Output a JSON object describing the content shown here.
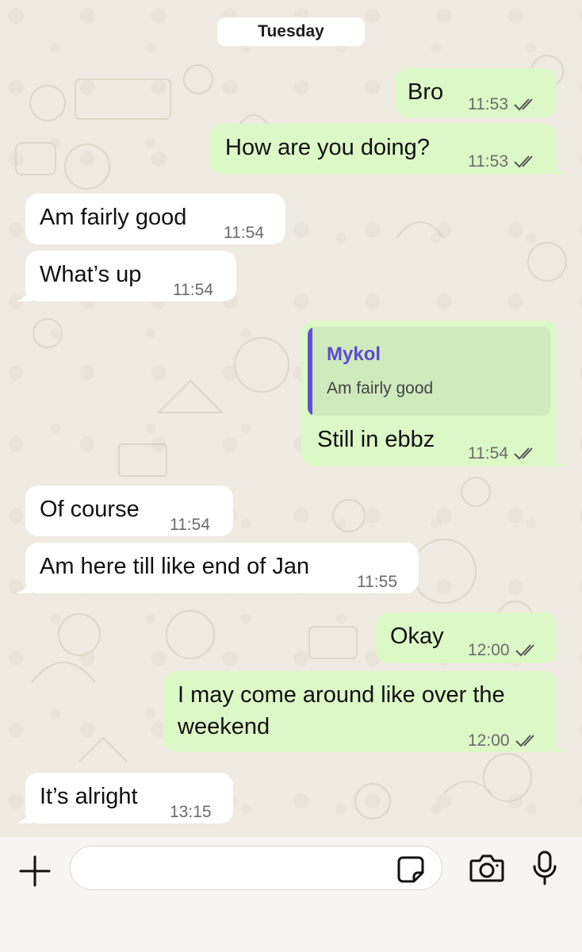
{
  "date_separator": "Tuesday",
  "messages": [
    {
      "direction": "out",
      "text": "Bro",
      "time": "11:53",
      "status": "read"
    },
    {
      "direction": "out",
      "text": "How are you doing?",
      "time": "11:53",
      "status": "read"
    },
    {
      "direction": "in",
      "text": "Am fairly good",
      "time": "11:54"
    },
    {
      "direction": "in",
      "text": "What’s up",
      "time": "11:54"
    },
    {
      "direction": "out",
      "reply_to": {
        "author": "Mykol",
        "text": "Am fairly good"
      },
      "text": "Still in ebbz",
      "time": "11:54",
      "status": "read"
    },
    {
      "direction": "in",
      "text": "Of course",
      "time": "11:54"
    },
    {
      "direction": "in",
      "text": "Am here till like end of Jan",
      "time": "11:55"
    },
    {
      "direction": "out",
      "text": "Okay",
      "time": "12:00",
      "status": "read"
    },
    {
      "direction": "out",
      "text_lines": [
        "I may come around like over the",
        "weekend"
      ],
      "time": "12:00",
      "status": "read"
    },
    {
      "direction": "in",
      "text": "It’s alright",
      "time": "13:15"
    }
  ],
  "composer": {
    "placeholder": "",
    "icons": [
      "plus-icon",
      "sticker-icon",
      "camera-icon",
      "microphone-icon"
    ]
  },
  "colors": {
    "chat_background": "#efeae2",
    "incoming_bubble": "#ffffff",
    "outgoing_bubble": "#dcf8c6",
    "quote_accent": "#5e4fd6"
  }
}
